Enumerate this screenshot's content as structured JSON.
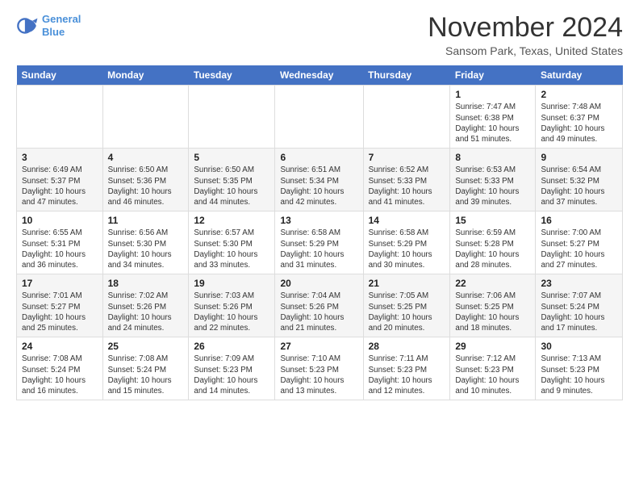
{
  "header": {
    "logo_line1": "General",
    "logo_line2": "Blue",
    "month": "November 2024",
    "location": "Sansom Park, Texas, United States"
  },
  "weekdays": [
    "Sunday",
    "Monday",
    "Tuesday",
    "Wednesday",
    "Thursday",
    "Friday",
    "Saturday"
  ],
  "weeks": [
    [
      {
        "day": "",
        "info": ""
      },
      {
        "day": "",
        "info": ""
      },
      {
        "day": "",
        "info": ""
      },
      {
        "day": "",
        "info": ""
      },
      {
        "day": "",
        "info": ""
      },
      {
        "day": "1",
        "info": "Sunrise: 7:47 AM\nSunset: 6:38 PM\nDaylight: 10 hours\nand 51 minutes."
      },
      {
        "day": "2",
        "info": "Sunrise: 7:48 AM\nSunset: 6:37 PM\nDaylight: 10 hours\nand 49 minutes."
      }
    ],
    [
      {
        "day": "3",
        "info": "Sunrise: 6:49 AM\nSunset: 5:37 PM\nDaylight: 10 hours\nand 47 minutes."
      },
      {
        "day": "4",
        "info": "Sunrise: 6:50 AM\nSunset: 5:36 PM\nDaylight: 10 hours\nand 46 minutes."
      },
      {
        "day": "5",
        "info": "Sunrise: 6:50 AM\nSunset: 5:35 PM\nDaylight: 10 hours\nand 44 minutes."
      },
      {
        "day": "6",
        "info": "Sunrise: 6:51 AM\nSunset: 5:34 PM\nDaylight: 10 hours\nand 42 minutes."
      },
      {
        "day": "7",
        "info": "Sunrise: 6:52 AM\nSunset: 5:33 PM\nDaylight: 10 hours\nand 41 minutes."
      },
      {
        "day": "8",
        "info": "Sunrise: 6:53 AM\nSunset: 5:33 PM\nDaylight: 10 hours\nand 39 minutes."
      },
      {
        "day": "9",
        "info": "Sunrise: 6:54 AM\nSunset: 5:32 PM\nDaylight: 10 hours\nand 37 minutes."
      }
    ],
    [
      {
        "day": "10",
        "info": "Sunrise: 6:55 AM\nSunset: 5:31 PM\nDaylight: 10 hours\nand 36 minutes."
      },
      {
        "day": "11",
        "info": "Sunrise: 6:56 AM\nSunset: 5:30 PM\nDaylight: 10 hours\nand 34 minutes."
      },
      {
        "day": "12",
        "info": "Sunrise: 6:57 AM\nSunset: 5:30 PM\nDaylight: 10 hours\nand 33 minutes."
      },
      {
        "day": "13",
        "info": "Sunrise: 6:58 AM\nSunset: 5:29 PM\nDaylight: 10 hours\nand 31 minutes."
      },
      {
        "day": "14",
        "info": "Sunrise: 6:58 AM\nSunset: 5:29 PM\nDaylight: 10 hours\nand 30 minutes."
      },
      {
        "day": "15",
        "info": "Sunrise: 6:59 AM\nSunset: 5:28 PM\nDaylight: 10 hours\nand 28 minutes."
      },
      {
        "day": "16",
        "info": "Sunrise: 7:00 AM\nSunset: 5:27 PM\nDaylight: 10 hours\nand 27 minutes."
      }
    ],
    [
      {
        "day": "17",
        "info": "Sunrise: 7:01 AM\nSunset: 5:27 PM\nDaylight: 10 hours\nand 25 minutes."
      },
      {
        "day": "18",
        "info": "Sunrise: 7:02 AM\nSunset: 5:26 PM\nDaylight: 10 hours\nand 24 minutes."
      },
      {
        "day": "19",
        "info": "Sunrise: 7:03 AM\nSunset: 5:26 PM\nDaylight: 10 hours\nand 22 minutes."
      },
      {
        "day": "20",
        "info": "Sunrise: 7:04 AM\nSunset: 5:26 PM\nDaylight: 10 hours\nand 21 minutes."
      },
      {
        "day": "21",
        "info": "Sunrise: 7:05 AM\nSunset: 5:25 PM\nDaylight: 10 hours\nand 20 minutes."
      },
      {
        "day": "22",
        "info": "Sunrise: 7:06 AM\nSunset: 5:25 PM\nDaylight: 10 hours\nand 18 minutes."
      },
      {
        "day": "23",
        "info": "Sunrise: 7:07 AM\nSunset: 5:24 PM\nDaylight: 10 hours\nand 17 minutes."
      }
    ],
    [
      {
        "day": "24",
        "info": "Sunrise: 7:08 AM\nSunset: 5:24 PM\nDaylight: 10 hours\nand 16 minutes."
      },
      {
        "day": "25",
        "info": "Sunrise: 7:08 AM\nSunset: 5:24 PM\nDaylight: 10 hours\nand 15 minutes."
      },
      {
        "day": "26",
        "info": "Sunrise: 7:09 AM\nSunset: 5:23 PM\nDaylight: 10 hours\nand 14 minutes."
      },
      {
        "day": "27",
        "info": "Sunrise: 7:10 AM\nSunset: 5:23 PM\nDaylight: 10 hours\nand 13 minutes."
      },
      {
        "day": "28",
        "info": "Sunrise: 7:11 AM\nSunset: 5:23 PM\nDaylight: 10 hours\nand 12 minutes."
      },
      {
        "day": "29",
        "info": "Sunrise: 7:12 AM\nSunset: 5:23 PM\nDaylight: 10 hours\nand 10 minutes."
      },
      {
        "day": "30",
        "info": "Sunrise: 7:13 AM\nSunset: 5:23 PM\nDaylight: 10 hours\nand 9 minutes."
      }
    ]
  ]
}
